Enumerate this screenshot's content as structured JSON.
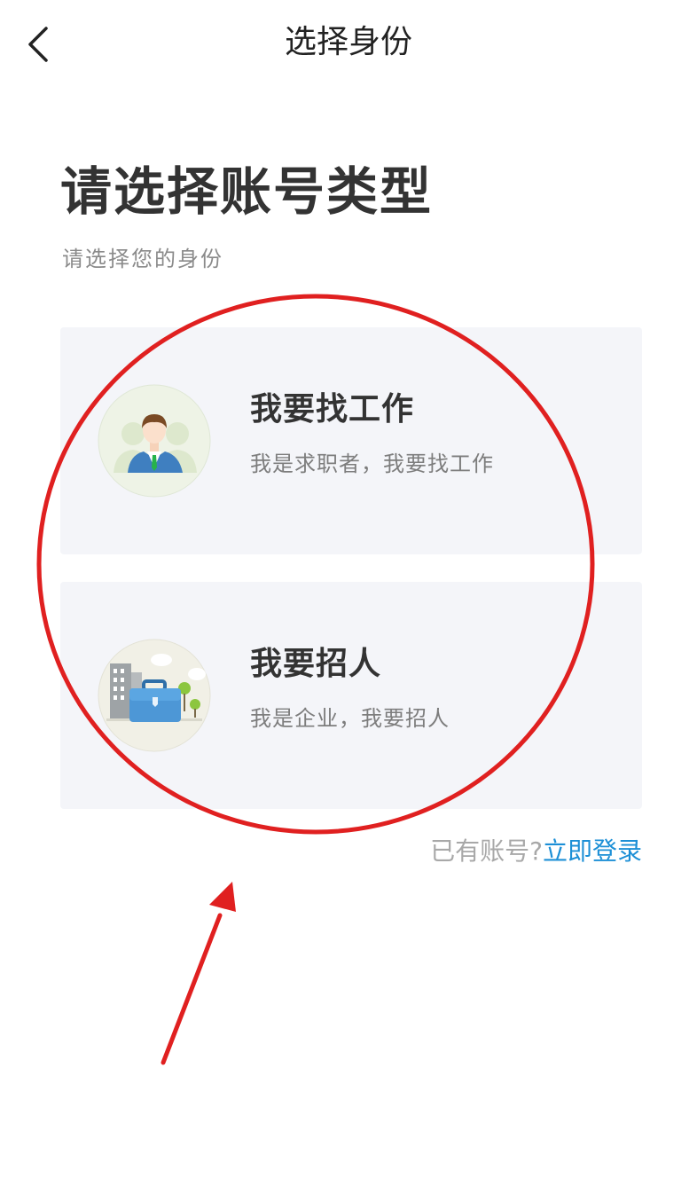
{
  "nav": {
    "back_icon": "chevron-left-icon",
    "title": "选择身份"
  },
  "main": {
    "heading": "请选择账号类型",
    "subheading": "请选择您的身份"
  },
  "cards": [
    {
      "title": "我要找工作",
      "description": "我是求职者，我要找工作",
      "icon": "job-seeker-avatar-icon"
    },
    {
      "title": "我要招人",
      "description": "我是企业，我要招人",
      "icon": "employer-briefcase-icon"
    }
  ],
  "footer": {
    "login_prompt": "已有账号?",
    "login_link": "立即登录",
    "link_color": "#1c8fd6"
  },
  "annotation": {
    "color": "#e02020",
    "shapes": [
      "circle-highlight",
      "arrow"
    ]
  }
}
